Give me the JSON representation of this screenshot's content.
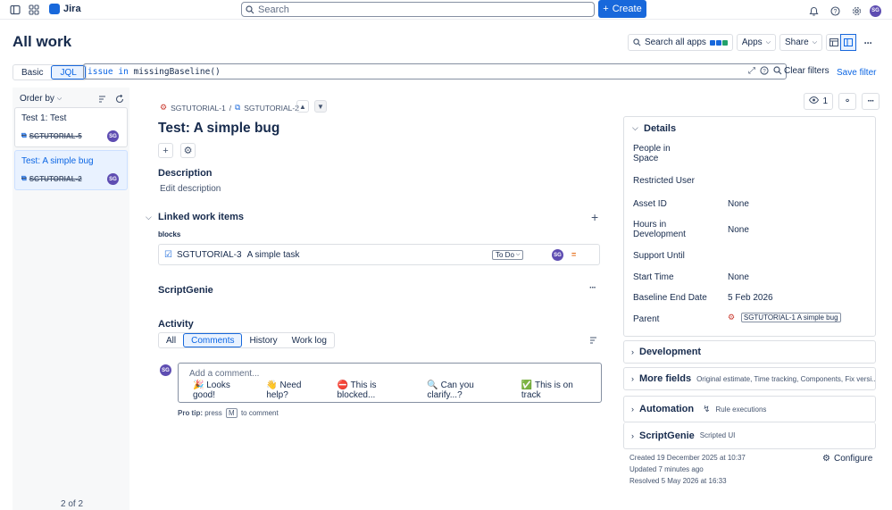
{
  "topbar": {
    "app_name": "Jira",
    "search_placeholder": "Search",
    "create_label": "Create",
    "avatar_initials": "SG"
  },
  "page": {
    "title": "All work",
    "search_apps_label": "Search all apps",
    "apps_label": "Apps",
    "share_label": "Share"
  },
  "filter": {
    "basic_label": "Basic",
    "jql_label": "JQL",
    "jql_keyword_in": "in",
    "jql_field": "issue",
    "jql_func": "missingBaseline()",
    "clear_filters": "Clear filters",
    "save_filter": "Save filter"
  },
  "list": {
    "order_by": "Order by",
    "items": [
      {
        "title": "Test 1: Test",
        "key": "SGTUTORIAL-5",
        "avatar": "SG"
      },
      {
        "title": "Test: A simple bug",
        "key": "SGTUTORIAL-2",
        "avatar": "SG"
      }
    ],
    "count": "2 of 2"
  },
  "issue": {
    "parent_key": "SGTUTORIAL-1",
    "key": "SGTUTORIAL-2",
    "title": "Test: A simple bug",
    "description_heading": "Description",
    "edit_description": "Edit description",
    "linked_heading": "Linked work items",
    "link_type": "blocks",
    "linked_item": {
      "key": "SGTUTORIAL-3",
      "summary": "A simple task",
      "status": "To Do",
      "avatar": "SG"
    },
    "scriptgenie_heading": "ScriptGenie",
    "activity_heading": "Activity",
    "activity_tabs": [
      "All",
      "Comments",
      "History",
      "Work log"
    ],
    "active_tab": 1,
    "comment_placeholder": "Add a comment...",
    "quick_replies": [
      {
        "emoji": "🎉",
        "label": "Looks good!"
      },
      {
        "emoji": "👋",
        "label": "Need help?"
      },
      {
        "emoji": "⛔",
        "label": "This is blocked..."
      },
      {
        "emoji": "🔍",
        "label": "Can you clarify...?"
      },
      {
        "emoji": "✅",
        "label": "This is on track"
      }
    ],
    "protip_prefix": "Pro tip:",
    "protip_press": "press",
    "protip_key": "M",
    "protip_suffix": "to comment",
    "commenter_avatar": "SG"
  },
  "right": {
    "watch_count": "1",
    "details_heading": "Details",
    "fields": [
      {
        "label": "People in Space",
        "value": ""
      },
      {
        "label": "Restricted User",
        "value": ""
      },
      {
        "label": "Asset ID",
        "value": "None"
      },
      {
        "label": "Hours in Development",
        "value": "None"
      },
      {
        "label": "Support Until",
        "value": ""
      },
      {
        "label": "Start Time",
        "value": "None"
      },
      {
        "label": "Baseline End Date",
        "value": "5 Feb 2026"
      },
      {
        "label": "Parent",
        "value": "SGTUTORIAL-1 A simple bug"
      }
    ],
    "development": "Development",
    "more_fields": "More fields",
    "more_fields_sub": "Original estimate, Time tracking, Components, Fix versi...",
    "automation": "Automation",
    "automation_sub": "Rule executions",
    "scriptgenie": "ScriptGenie",
    "scriptgenie_sub": "Scripted UI",
    "created": "Created 19 December 2025 at 10:37",
    "updated": "Updated 7 minutes ago",
    "resolved": "Resolved 5 May 2026 at 16:33",
    "configure": "Configure"
  },
  "colors": {
    "brand": "#1868db",
    "selected_bg": "#e9f2ff",
    "priority": "#e56910"
  }
}
